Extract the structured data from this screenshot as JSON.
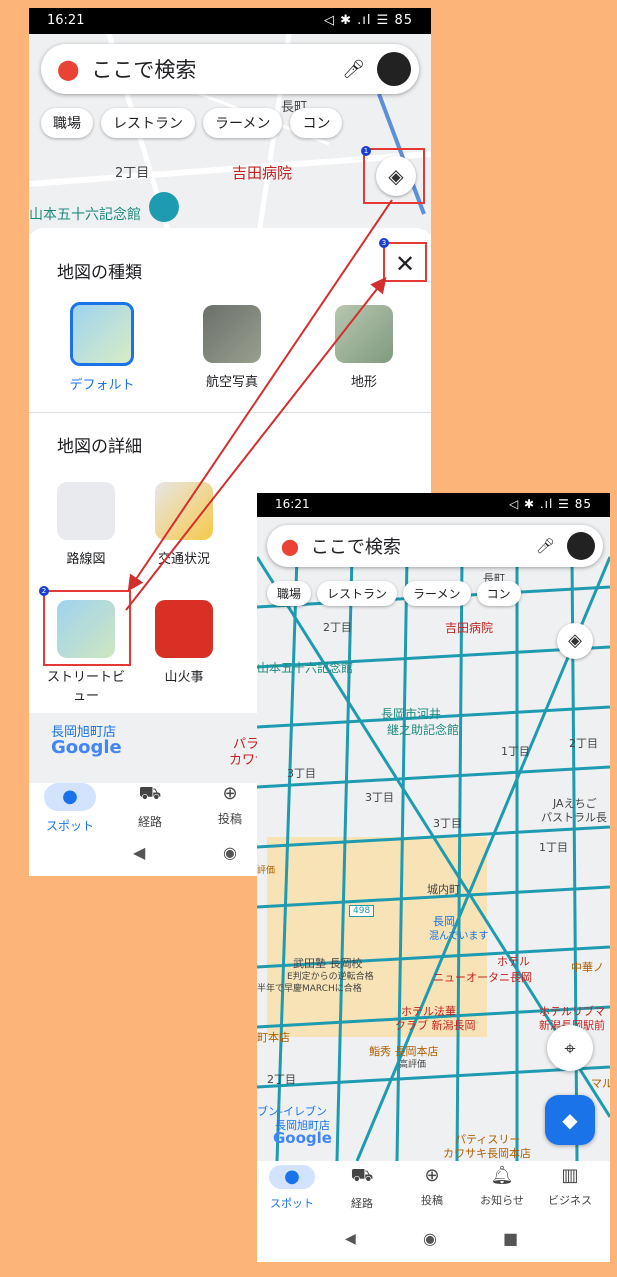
{
  "phone1": {
    "status": {
      "time": "16:21",
      "right": "◁ ✱ .ıl ☰ 85"
    },
    "search": {
      "placeholder": "ここで検索"
    },
    "chips": [
      "職場",
      "レストラン",
      "ラーメン",
      "コン"
    ],
    "map_labels": {
      "a": "2丁目",
      "b": "吉田病院",
      "c": "山本五十六記念館",
      "d": "長町"
    },
    "sheet": {
      "map_type_title": "地図の種類",
      "map_types": [
        "デフォルト",
        "航空写真",
        "地形"
      ],
      "details_title": "地図の詳細",
      "details_row1": [
        "路線図",
        "交通状況"
      ],
      "details_row2": [
        "ストリートビュー",
        "山火事"
      ]
    },
    "below_labels": {
      "a": "長岡旭町店",
      "b": "Google",
      "c": "パラ",
      "d": "カワサキ"
    },
    "nav": [
      {
        "label": "スポット",
        "icon": "pin-icon"
      },
      {
        "label": "経路",
        "icon": "car-icon"
      },
      {
        "label": "投稿",
        "icon": "plus-circle-icon"
      }
    ],
    "badges": {
      "one": "1",
      "two": "2",
      "three": "3"
    }
  },
  "phone2": {
    "status": {
      "time": "16:21",
      "right": "◁ ✱ .ıl ☰ 85"
    },
    "search": {
      "placeholder": "ここで検索"
    },
    "chips": [
      "職場",
      "レストラン",
      "ラーメン",
      "コン"
    ],
    "map_labels": {
      "l1": "長町",
      "l2": "2丁目",
      "l3": "吉田病院",
      "l4": "山本五十六記念館",
      "l5": "長岡市河井",
      "l6": "継之助記念館",
      "l7": "1丁目",
      "l8": "2丁目",
      "l9": "3丁目",
      "l10": "3丁目",
      "l11": "3丁目",
      "l12": "JAえちご",
      "l13": "パストラル長",
      "l14": "1丁目",
      "l15": "城内町",
      "l16": "長岡",
      "l17": "混んでいます",
      "l18": "ホテル",
      "l19": "ニューオータニ長岡",
      "l20": "武田塾 長岡校",
      "l21": "E判定からの逆転合格",
      "l22": "半年で早慶MARCHに合格",
      "l23": "ホテル法華",
      "l24": "クラブ 新潟長岡",
      "l25": "ホテルリブマ",
      "l26": "新潟長岡駅前",
      "l27": "鮨秀 長岡本店",
      "l28": "高評価",
      "l29": "町本店",
      "l30": "2丁目",
      "l31": "ブン-イレブン",
      "l32": "長岡旭町店",
      "l33": "Google",
      "l34": "パティスリー",
      "l35": "カワサキ長岡本店",
      "l36": "中華ノ",
      "l37": "498",
      "l38": "マル",
      "l39": "評価"
    },
    "nav": [
      {
        "label": "スポット",
        "icon": "pin-icon"
      },
      {
        "label": "経路",
        "icon": "car-icon"
      },
      {
        "label": "投稿",
        "icon": "plus-circle-icon"
      },
      {
        "label": "お知らせ",
        "icon": "bell-icon"
      },
      {
        "label": "ビジネス",
        "icon": "store-icon"
      }
    ]
  },
  "colors": {
    "background": "#fcb479",
    "highlight": "#e53935",
    "accent": "#1a73e8",
    "street_view": "#1e9bb0"
  }
}
